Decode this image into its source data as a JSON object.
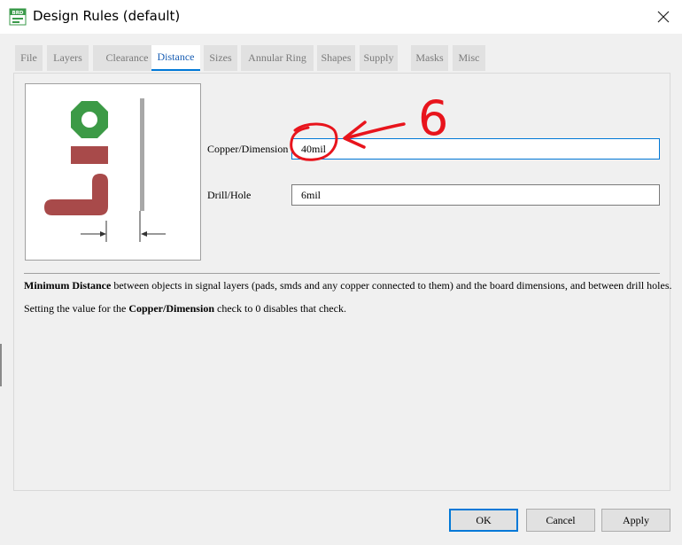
{
  "window": {
    "title": "Design Rules (default)",
    "icon_text": "BRD"
  },
  "tabs": [
    {
      "label": "File"
    },
    {
      "label": "Layers"
    },
    {
      "label": "Clearance"
    },
    {
      "label": "Distance",
      "active": true
    },
    {
      "label": "Sizes"
    },
    {
      "label": "Annular Ring"
    },
    {
      "label": "Shapes"
    },
    {
      "label": "Supply"
    },
    {
      "label": "Masks"
    },
    {
      "label": "Misc"
    }
  ],
  "fields": {
    "copper_dimension": {
      "label": "Copper/Dimension",
      "value": "40mil"
    },
    "drill_hole": {
      "label": "Drill/Hole",
      "value": "6mil"
    }
  },
  "description": {
    "line1_bold": "Minimum Distance",
    "line1_rest": " between objects in signal layers (pads, smds and any copper connected to them) and the board dimensions, and between drill holes.",
    "line2_prefix": "Setting the value for the ",
    "line2_bold": "Copper/Dimension",
    "line2_suffix": " check to 0 disables that check."
  },
  "buttons": {
    "ok": "OK",
    "cancel": "Cancel",
    "apply": "Apply"
  },
  "annotation": {
    "text": "6",
    "color": "#e8141c"
  },
  "colors": {
    "accent": "#0078d7",
    "pad_green": "#3c9a46",
    "trace_red": "#a84a4a",
    "dimension_gray": "#a8a8a8"
  }
}
